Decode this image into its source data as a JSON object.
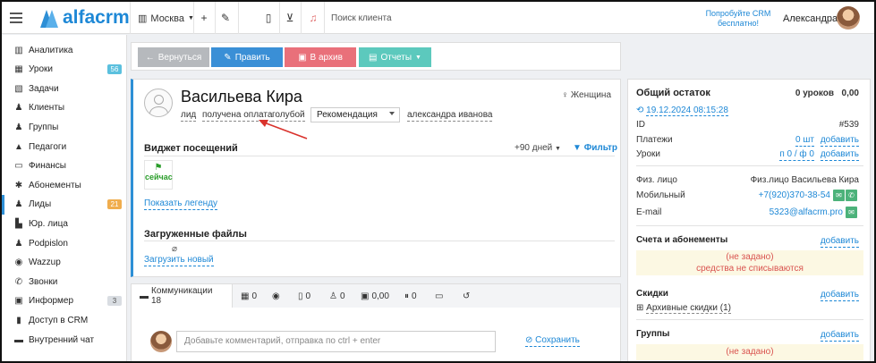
{
  "header": {
    "logo": "alfacrm",
    "city": "Москва",
    "search_placeholder": "Поиск клиента",
    "promo": "Попробуйте CRM бесплатно!",
    "user": "Александра"
  },
  "sidebar": {
    "items": [
      {
        "label": "Аналитика",
        "icon": "book-icon"
      },
      {
        "label": "Уроки",
        "icon": "calendar-icon",
        "badge": "56",
        "badge_color": "#5bc0de"
      },
      {
        "label": "Задачи",
        "icon": "calendar-check-icon"
      },
      {
        "label": "Клиенты",
        "icon": "user-icon"
      },
      {
        "label": "Группы",
        "icon": "users-icon"
      },
      {
        "label": "Педагоги",
        "icon": "graduation-cap-icon"
      },
      {
        "label": "Финансы",
        "icon": "money-icon"
      },
      {
        "label": "Абонементы",
        "icon": "gear-icon"
      },
      {
        "label": "Лиды",
        "icon": "user-plus-icon",
        "badge": "21",
        "badge_color": "#f0ad4e"
      },
      {
        "label": "Юр. лица",
        "icon": "building-icon"
      },
      {
        "label": "Podpislon",
        "icon": "thumbs-up-icon"
      },
      {
        "label": "Wazzup",
        "icon": "whatsapp-icon"
      },
      {
        "label": "Звонки",
        "icon": "phone-icon"
      },
      {
        "label": "Информер",
        "icon": "briefcase-icon",
        "badge": "3",
        "badge_color": "#d9dde2"
      },
      {
        "label": "Доступ в CRM",
        "icon": "lock-icon"
      },
      {
        "label": "Внутренний чат",
        "icon": "chat-icon"
      }
    ]
  },
  "toolbar": {
    "back": "Вернуться",
    "edit": "Править",
    "archive": "В архив",
    "reports": "Отчеты",
    "colors": {
      "back": "#b6b9bd",
      "edit": "#3a8fd6",
      "archive": "#e9707a",
      "reports": "#5cc9bd"
    }
  },
  "client": {
    "name": "Васильева Кира",
    "gender": "Женщина",
    "tags": [
      "лид",
      "получена оплата",
      "голубой"
    ],
    "recommendation": "Рекомендация",
    "manager": "александра иванова"
  },
  "visits": {
    "title": "Виджет посещений",
    "days": "+90 дней",
    "filter": "Фильтр",
    "cell_label": "сейчас",
    "legend_link": "Показать легенду"
  },
  "files": {
    "title": "Загруженные файлы",
    "upload_link": "Загрузить новый"
  },
  "tabs": {
    "communications": "Коммуникации 18",
    "counts": [
      "0",
      "0",
      "0",
      "0",
      "0,00",
      "0"
    ]
  },
  "comment": {
    "placeholder": "Добавьте комментарий, отправка по ctrl + enter",
    "save": "Сохранить"
  },
  "right": {
    "balance_title": "Общий остаток",
    "balance_lessons": "0 уроков",
    "balance_amount": "0,00",
    "datetime": "19.12.2024 08:15:28",
    "id_label": "ID",
    "id_value": "#539",
    "payments_label": "Платежи",
    "payments_value": "0 шт",
    "payments_add": "добавить",
    "lessons_label": "Уроки",
    "lessons_value": "п 0 / ф 0",
    "lessons_add": "добавить",
    "person_label": "Физ. лицо",
    "person_value": "Физ.лицо Васильева Кира",
    "mobile_label": "Мобильный",
    "mobile_value": "+7(920)370-38-54",
    "email_label": "E-mail",
    "email_value": "5323@alfacrm.pro",
    "accounts_title": "Счета и абонементы",
    "accounts_add": "добавить",
    "not_set": "(не задано)",
    "not_charged": "средства не списываются",
    "discounts_title": "Скидки",
    "discounts_add": "добавить",
    "archive_discounts": "Архивные скидки (1)",
    "groups_title": "Группы",
    "groups_add": "добавить",
    "groups_not_set": "(не задано)"
  }
}
